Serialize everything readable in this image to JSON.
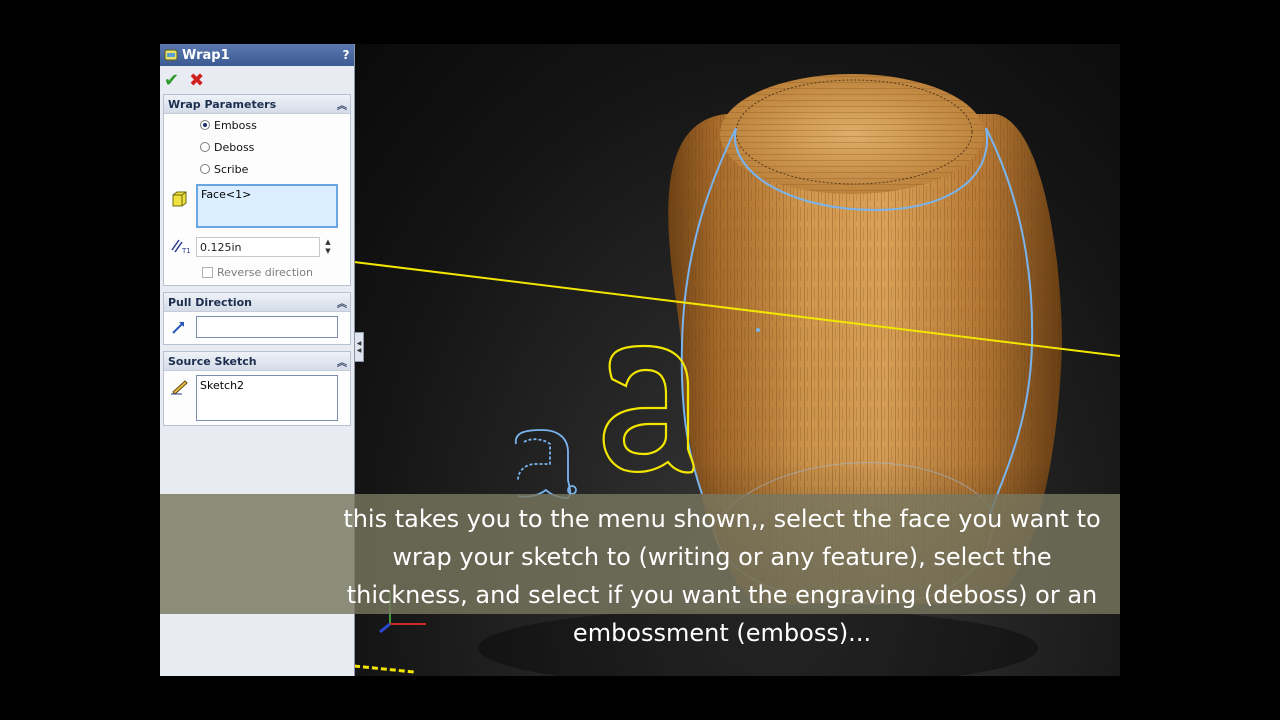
{
  "panel": {
    "title": "Wrap1",
    "help_label": "?",
    "ok_label": "✔",
    "cancel_label": "✖",
    "wrap_params": {
      "header": "Wrap Parameters",
      "options": [
        "Emboss",
        "Deboss",
        "Scribe"
      ],
      "selected": "Emboss",
      "face_value": "Face<1>",
      "thickness_value": "0.125in",
      "reverse_label": "Reverse direction",
      "reverse_checked": false
    },
    "pull_direction": {
      "header": "Pull Direction",
      "value": ""
    },
    "source_sketch": {
      "header": "Source Sketch",
      "value": "Sketch2"
    }
  },
  "caption": "this takes you to the menu shown,, select the face you want to wrap your sketch to (writing or any feature), select the thickness, and select if you want the engraving (deboss) or an embossment (emboss)...",
  "colors": {
    "wood_light": "#d89a4a",
    "wood_dark": "#8f5a22",
    "edge_highlight": "#7ab4ee",
    "sketch_yellow": "#f2e600",
    "caption_bg": "#78765f"
  },
  "icons": {
    "feature": "wrap-feature-icon",
    "face": "face-select-icon",
    "thickness": "thickness-icon",
    "pull": "pull-direction-arrow-icon",
    "sketch": "sketch-pencil-icon"
  }
}
